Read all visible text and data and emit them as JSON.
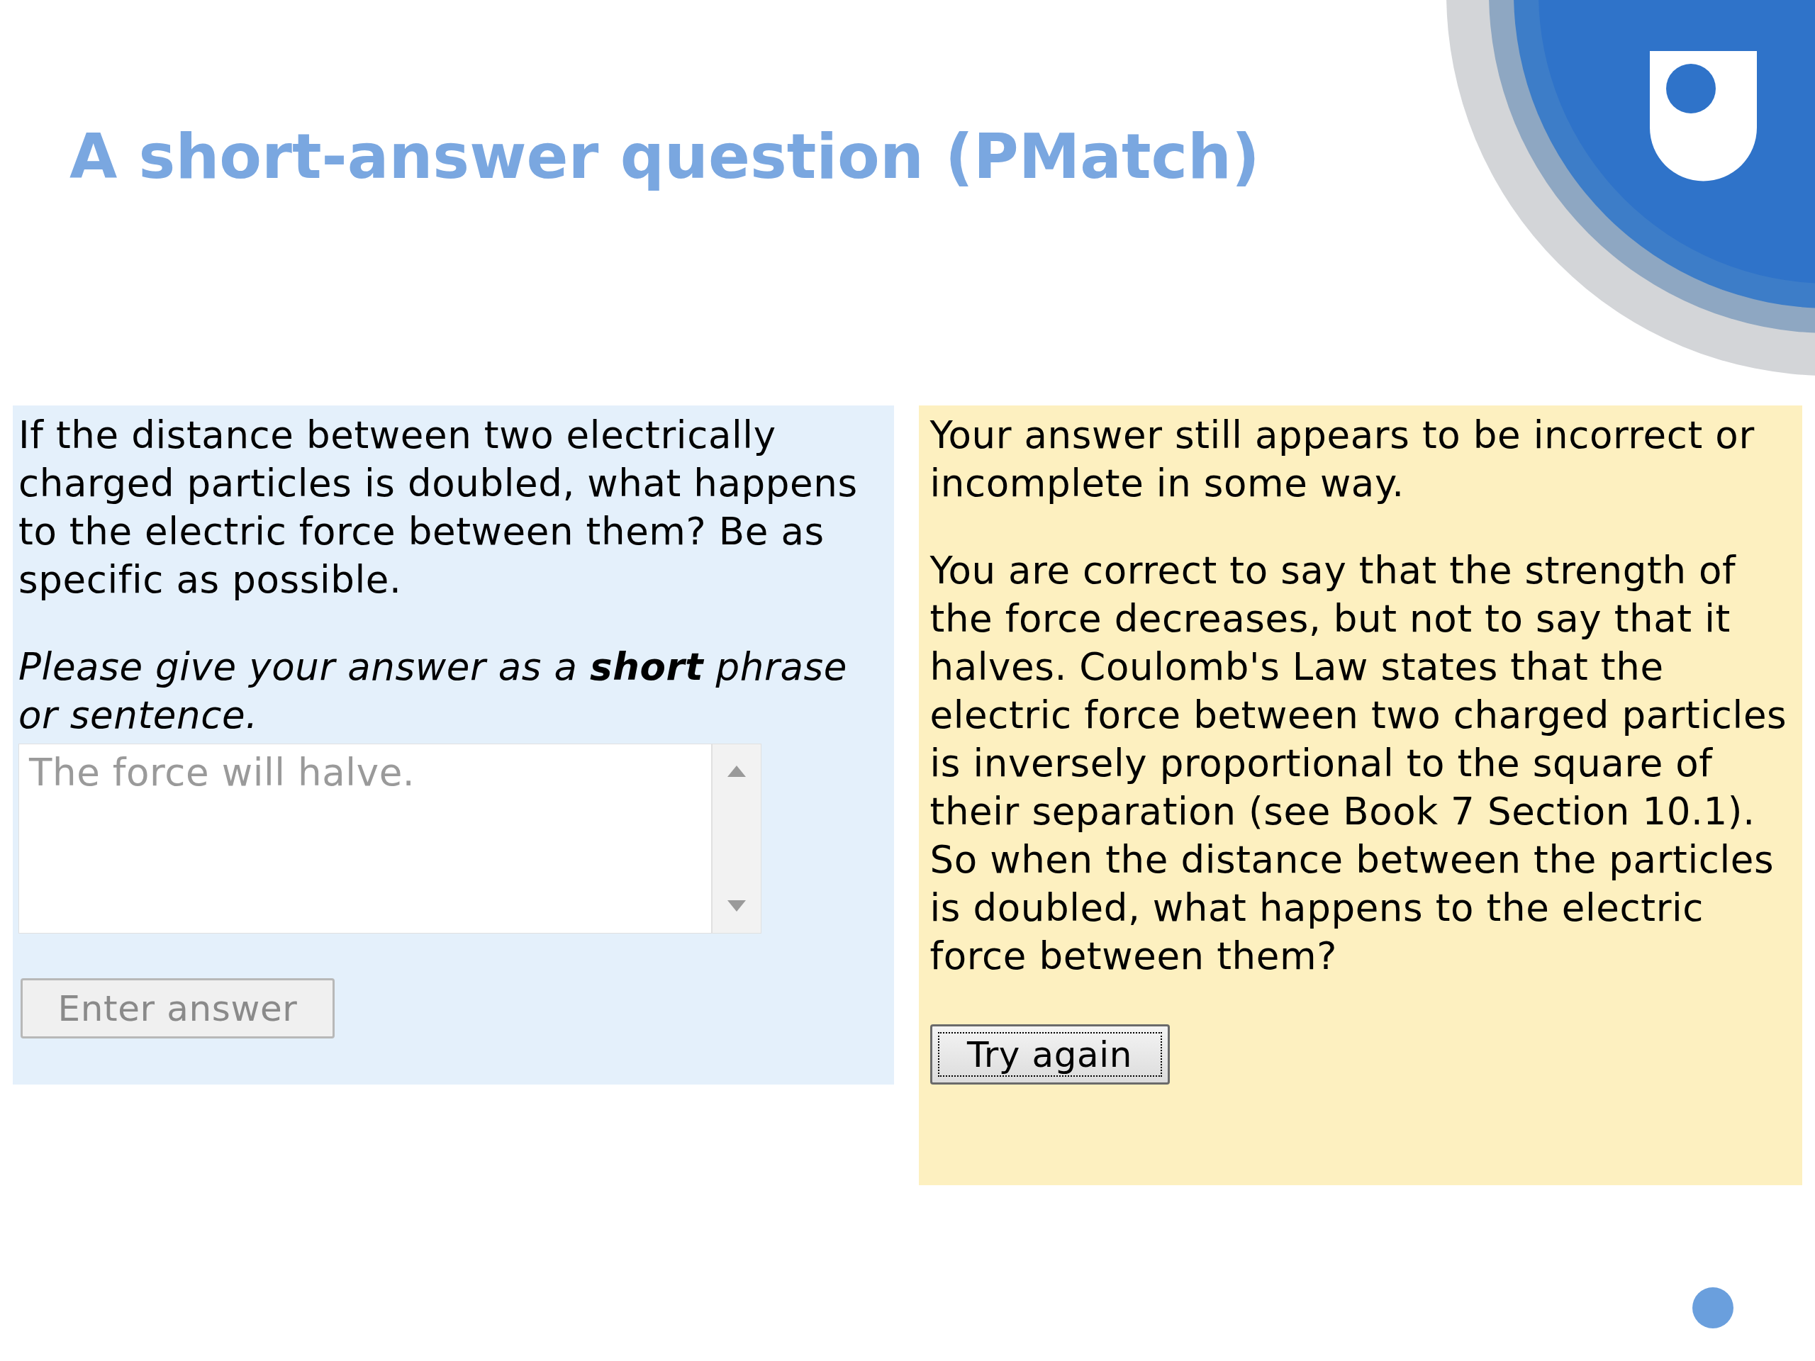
{
  "title": "A short-answer question (PMatch)",
  "question": {
    "text": "If the distance between two electrically charged particles is doubled, what happens to the electric force between them? Be as specific as possible.",
    "instruction": "Please give your answer as a **short** phrase or sentence.",
    "answer": {
      "value": "The force will halve.",
      "disabled": true
    },
    "submit_button": {
      "label": "Enter answer",
      "disabled": true
    }
  },
  "feedback": {
    "paragraphs": [
      "Your answer still appears to be incorrect or incomplete in some way.",
      "You are correct to say that the strength of the force decreases, but not to say that it halves. Coulomb's Law states that the electric force between two charged particles is inversely proportional to the square of their separation (see Book 7 Section 10.1). So when the distance between the particles is doubled, what happens to the electric force between them?"
    ],
    "button": {
      "label": "Try again",
      "focused": true
    }
  }
}
